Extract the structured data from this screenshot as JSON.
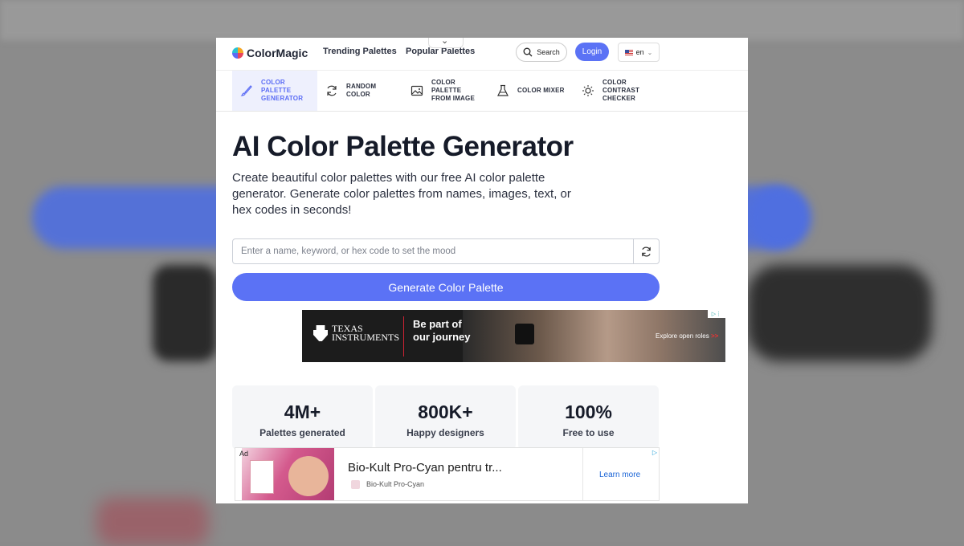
{
  "header": {
    "brand": "ColorMagic",
    "nav": [
      "Trending Palettes",
      "Popular Palettes"
    ],
    "search_label": "Search",
    "login_label": "Login",
    "language": "en"
  },
  "tool_tabs": [
    {
      "label": "COLOR\nPALETTE\nGENERATOR",
      "icon": "brush-icon",
      "active": true
    },
    {
      "label": "RANDOM\nCOLOR",
      "icon": "refresh-icon",
      "active": false
    },
    {
      "label": "COLOR\nPALETTE\nFROM IMAGE",
      "icon": "image-icon",
      "active": false
    },
    {
      "label": "COLOR MIXER",
      "icon": "flask-icon",
      "active": false
    },
    {
      "label": "COLOR\nCONTRAST\nCHECKER",
      "icon": "sun-icon",
      "active": false
    }
  ],
  "hero": {
    "title": "AI Color Palette Generator",
    "subtitle": "Create beautiful color palettes with our free AI color palette generator. Generate color palettes from names, images, text, or hex codes in seconds!",
    "input_placeholder": "Enter a name, keyword, or hex code to set the mood",
    "input_value": "",
    "generate_label": "Generate Color Palette"
  },
  "ad_banner": {
    "logo_line1": "TEXAS",
    "logo_line2": "INSTRUMENTS",
    "headline_line1": "Be part of",
    "headline_line2": "our journey",
    "cta": "Explore open roles",
    "cta_arrow": ">>"
  },
  "stats": [
    {
      "value": "4M+",
      "label": "Palettes generated"
    },
    {
      "value": "800K+",
      "label": "Happy designers"
    },
    {
      "value": "100%",
      "label": "Free to use"
    }
  ],
  "bottom_ad": {
    "ad_label": "Ad",
    "title": "Bio-Kult Pro-Cyan pentru tr...",
    "brand": "Bio-Kult Pro-Cyan",
    "cta": "Learn more"
  },
  "colors": {
    "accent": "#5b72f5",
    "active_tab_bg": "#eef0fd",
    "text_dark": "#161b29"
  }
}
